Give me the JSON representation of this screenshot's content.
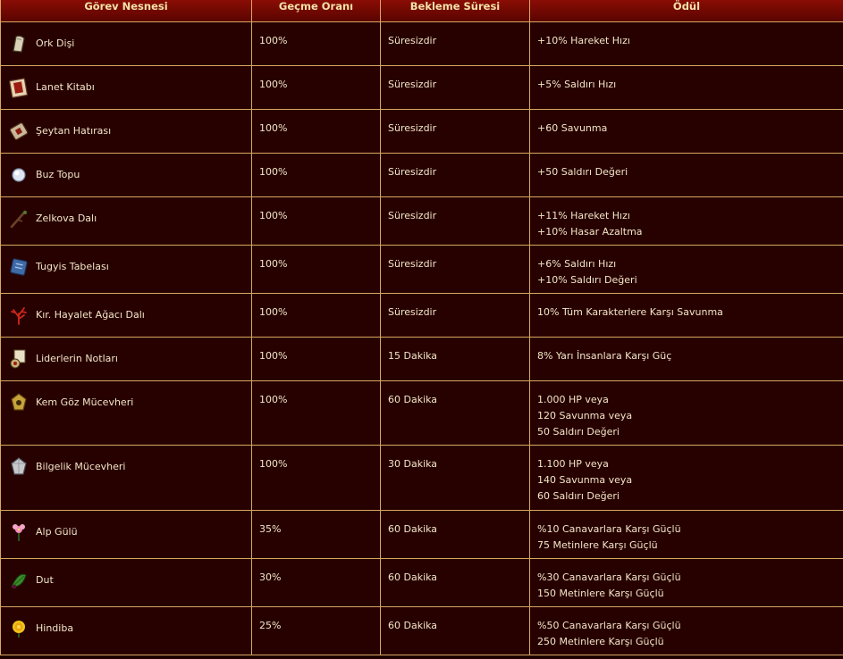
{
  "table": {
    "headers": {
      "item": "Görev Nesnesi",
      "rate": "Geçme Oranı",
      "wait": "Bekleme Süresi",
      "reward": "Ödül"
    },
    "rows": [
      {
        "icon": "ork-tooth-icon",
        "name": "Ork Dişi",
        "rate": "100%",
        "wait": "Süresizdir",
        "reward": [
          "+10% Hareket Hızı"
        ]
      },
      {
        "icon": "curse-book-icon",
        "name": "Lanet Kitabı",
        "rate": "100%",
        "wait": "Süresizdir",
        "reward": [
          "+5% Saldırı Hızı"
        ]
      },
      {
        "icon": "devil-keepsake-icon",
        "name": "Şeytan Hatırası",
        "rate": "100%",
        "wait": "Süresizdir",
        "reward": [
          "+60 Savunma"
        ]
      },
      {
        "icon": "ice-ball-icon",
        "name": "Buz Topu",
        "rate": "100%",
        "wait": "Süresizdir",
        "reward": [
          "+50 Saldırı Değeri"
        ]
      },
      {
        "icon": "zelkova-branch-icon",
        "name": "Zelkova Dalı",
        "rate": "100%",
        "wait": "Süresizdir",
        "reward": [
          "+11% Hareket Hızı",
          "+10% Hasar Azaltma"
        ]
      },
      {
        "icon": "tugyis-tablet-icon",
        "name": "Tugyis Tabelası",
        "rate": "100%",
        "wait": "Süresizdir",
        "reward": [
          "+6% Saldırı Hızı",
          "+10% Saldırı Değeri"
        ]
      },
      {
        "icon": "red-ghost-tree-branch-icon",
        "name": "Kır. Hayalet Ağacı Dalı",
        "rate": "100%",
        "wait": "Süresizdir",
        "reward": [
          "10% Tüm Karakterlere Karşı Savunma"
        ]
      },
      {
        "icon": "leaders-notes-icon",
        "name": "Liderlerin Notları",
        "rate": "100%",
        "wait": "15 Dakika",
        "reward": [
          "8% Yarı İnsanlara Karşı Güç"
        ]
      },
      {
        "icon": "evil-eye-gem-icon",
        "name": "Kem Göz Mücevheri",
        "rate": "100%",
        "wait": "60 Dakika",
        "reward": [
          "1.000 HP veya",
          "120 Savunma veya",
          "50 Saldırı Değeri"
        ]
      },
      {
        "icon": "wisdom-gem-icon",
        "name": "Bilgelik Mücevheri",
        "rate": "100%",
        "wait": "30 Dakika",
        "reward": [
          "1.100 HP veya",
          "140 Savunma veya",
          "60 Saldırı Değeri"
        ]
      },
      {
        "icon": "alpine-rose-icon",
        "name": "Alp Gülü",
        "rate": "35%",
        "wait": "60 Dakika",
        "reward": [
          "%10 Canavarlara Karşı Güçlü",
          "75 Metinlere Karşı Güçlü"
        ]
      },
      {
        "icon": "mulberry-icon",
        "name": "Dut",
        "rate": "30%",
        "wait": "60 Dakika",
        "reward": [
          "%30 Canavarlara Karşı Güçlü",
          "150 Metinlere Karşı Güçlü"
        ]
      },
      {
        "icon": "dandelion-icon",
        "name": "Hindiba",
        "rate": "25%",
        "wait": "60 Dakika",
        "reward": [
          "%50 Canavarlara Karşı Güçlü",
          "250 Metinlere Karşı Güçlü"
        ]
      }
    ]
  }
}
